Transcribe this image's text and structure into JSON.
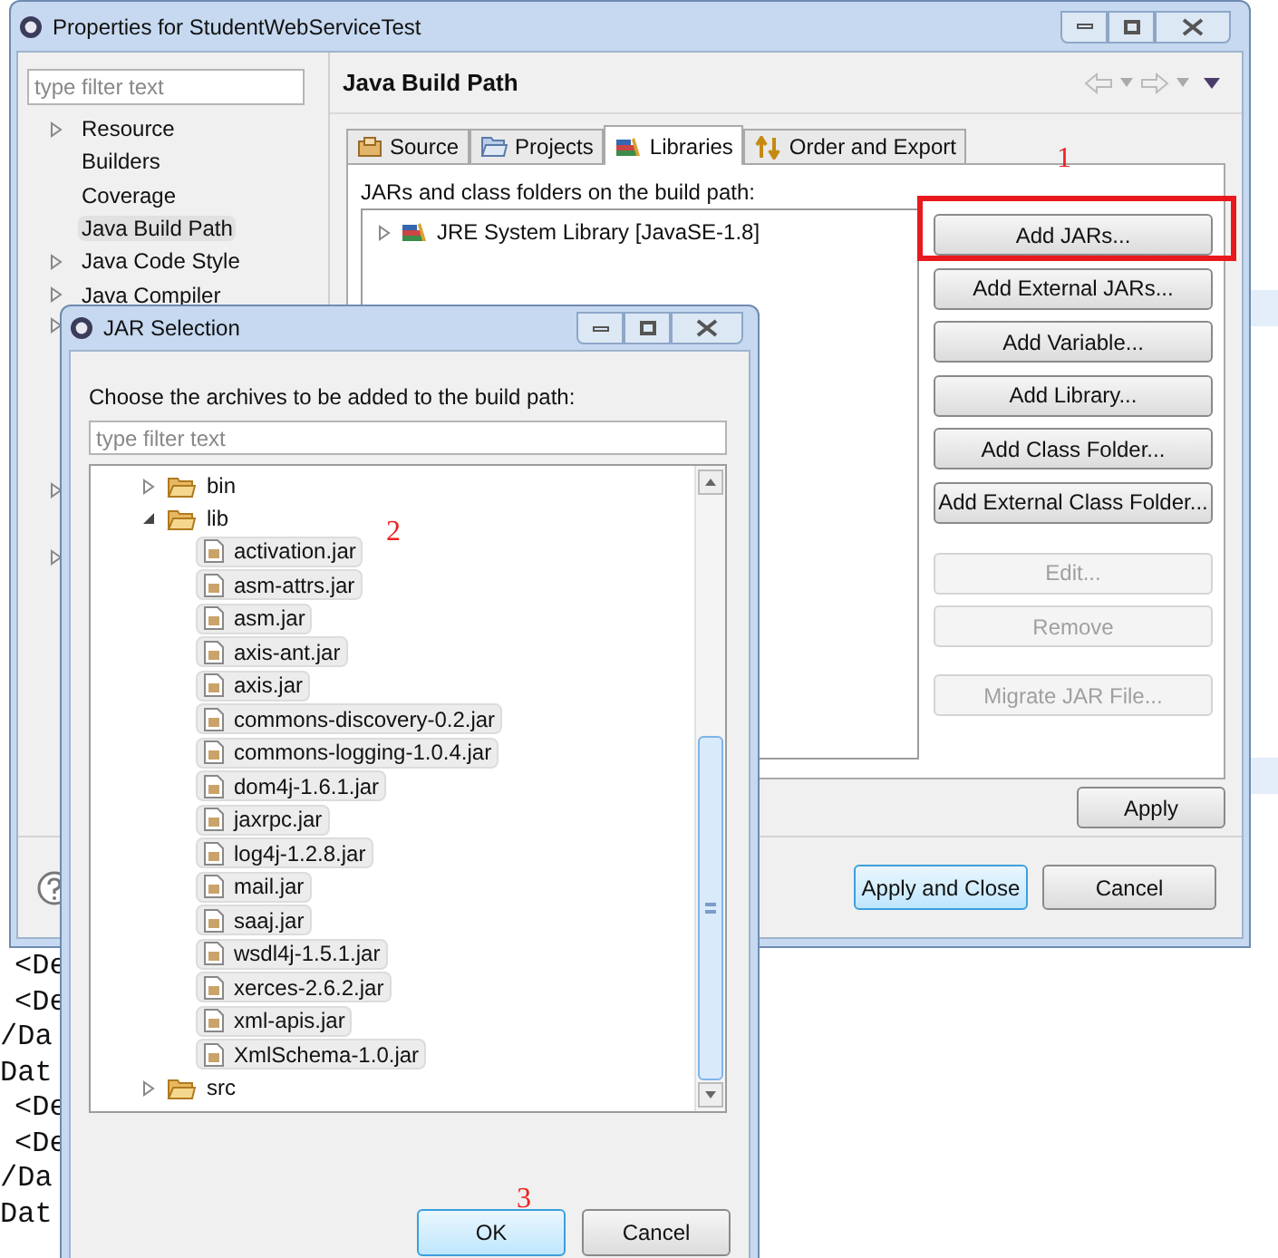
{
  "background_code": {
    "lines": [
      "<De",
      "<De",
      "/Da",
      "Dat",
      "<De",
      "<De",
      "/Da",
      "Dat"
    ]
  },
  "window": {
    "title": "Properties for StudentWebServiceTest"
  },
  "sidebar": {
    "filter_placeholder": "type filter text",
    "items": [
      {
        "label": "Resource",
        "expandable": true,
        "selected": false
      },
      {
        "label": "Builders",
        "expandable": false,
        "selected": false
      },
      {
        "label": "Coverage",
        "expandable": false,
        "selected": false
      },
      {
        "label": "Java Build Path",
        "expandable": false,
        "selected": true
      },
      {
        "label": "Java Code Style",
        "expandable": true,
        "selected": false
      },
      {
        "label": "Java Compiler",
        "expandable": true,
        "selected": false
      }
    ]
  },
  "page": {
    "title": "Java Build Path"
  },
  "tabs": [
    {
      "label": "Source",
      "kind": "source",
      "selected": false
    },
    {
      "label": "Projects",
      "kind": "projects",
      "selected": false
    },
    {
      "label": "Libraries",
      "kind": "libraries",
      "selected": true
    },
    {
      "label": "Order and Export",
      "kind": "order",
      "selected": false
    }
  ],
  "libraries": {
    "caption": "JARs and class folders on the build path:",
    "entries": [
      {
        "label": "JRE System Library [JavaSE-1.8]",
        "expanded": false
      }
    ],
    "buttons": [
      {
        "label": "Add JARs...",
        "disabled": false,
        "highlighted": true
      },
      {
        "label": "Add External JARs...",
        "disabled": false,
        "highlighted": false
      },
      {
        "label": "Add Variable...",
        "disabled": false,
        "highlighted": false
      },
      {
        "label": "Add Library...",
        "disabled": false,
        "highlighted": false
      },
      {
        "label": "Add Class Folder...",
        "disabled": false,
        "highlighted": false
      },
      {
        "label": "Add External Class Folder...",
        "disabled": false,
        "highlighted": false
      },
      {
        "label": "Edit...",
        "disabled": true,
        "highlighted": false
      },
      {
        "label": "Remove",
        "disabled": true,
        "highlighted": false
      },
      {
        "label": "Migrate JAR File...",
        "disabled": true,
        "highlighted": false
      }
    ]
  },
  "apply_button": "Apply",
  "footer_buttons": [
    {
      "label": "Apply and Close",
      "default": true
    },
    {
      "label": "Cancel",
      "default": false
    }
  ],
  "dialog": {
    "title": "JAR Selection",
    "caption": "Choose the archives to be added to the build path:",
    "filter_placeholder": "type filter text",
    "tree": [
      {
        "label": "bin",
        "kind": "folder",
        "expanded": false
      },
      {
        "label": "lib",
        "kind": "folder",
        "expanded": true,
        "children": [
          {
            "label": "activation.jar",
            "kind": "jar"
          },
          {
            "label": "asm-attrs.jar",
            "kind": "jar"
          },
          {
            "label": "asm.jar",
            "kind": "jar"
          },
          {
            "label": "axis-ant.jar",
            "kind": "jar"
          },
          {
            "label": "axis.jar",
            "kind": "jar"
          },
          {
            "label": "commons-discovery-0.2.jar",
            "kind": "jar"
          },
          {
            "label": "commons-logging-1.0.4.jar",
            "kind": "jar"
          },
          {
            "label": "dom4j-1.6.1.jar",
            "kind": "jar"
          },
          {
            "label": "jaxrpc.jar",
            "kind": "jar"
          },
          {
            "label": "log4j-1.2.8.jar",
            "kind": "jar"
          },
          {
            "label": "mail.jar",
            "kind": "jar"
          },
          {
            "label": "saaj.jar",
            "kind": "jar"
          },
          {
            "label": "wsdl4j-1.5.1.jar",
            "kind": "jar"
          },
          {
            "label": "xerces-2.6.2.jar",
            "kind": "jar"
          },
          {
            "label": "xml-apis.jar",
            "kind": "jar"
          },
          {
            "label": "XmlSchema-1.0.jar",
            "kind": "jar"
          }
        ]
      },
      {
        "label": "src",
        "kind": "folder",
        "expanded": false
      }
    ],
    "buttons": [
      {
        "label": "OK",
        "default": true
      },
      {
        "label": "Cancel",
        "default": false
      }
    ]
  },
  "annotations": [
    {
      "text": "1"
    },
    {
      "text": "2"
    },
    {
      "text": "3"
    }
  ]
}
